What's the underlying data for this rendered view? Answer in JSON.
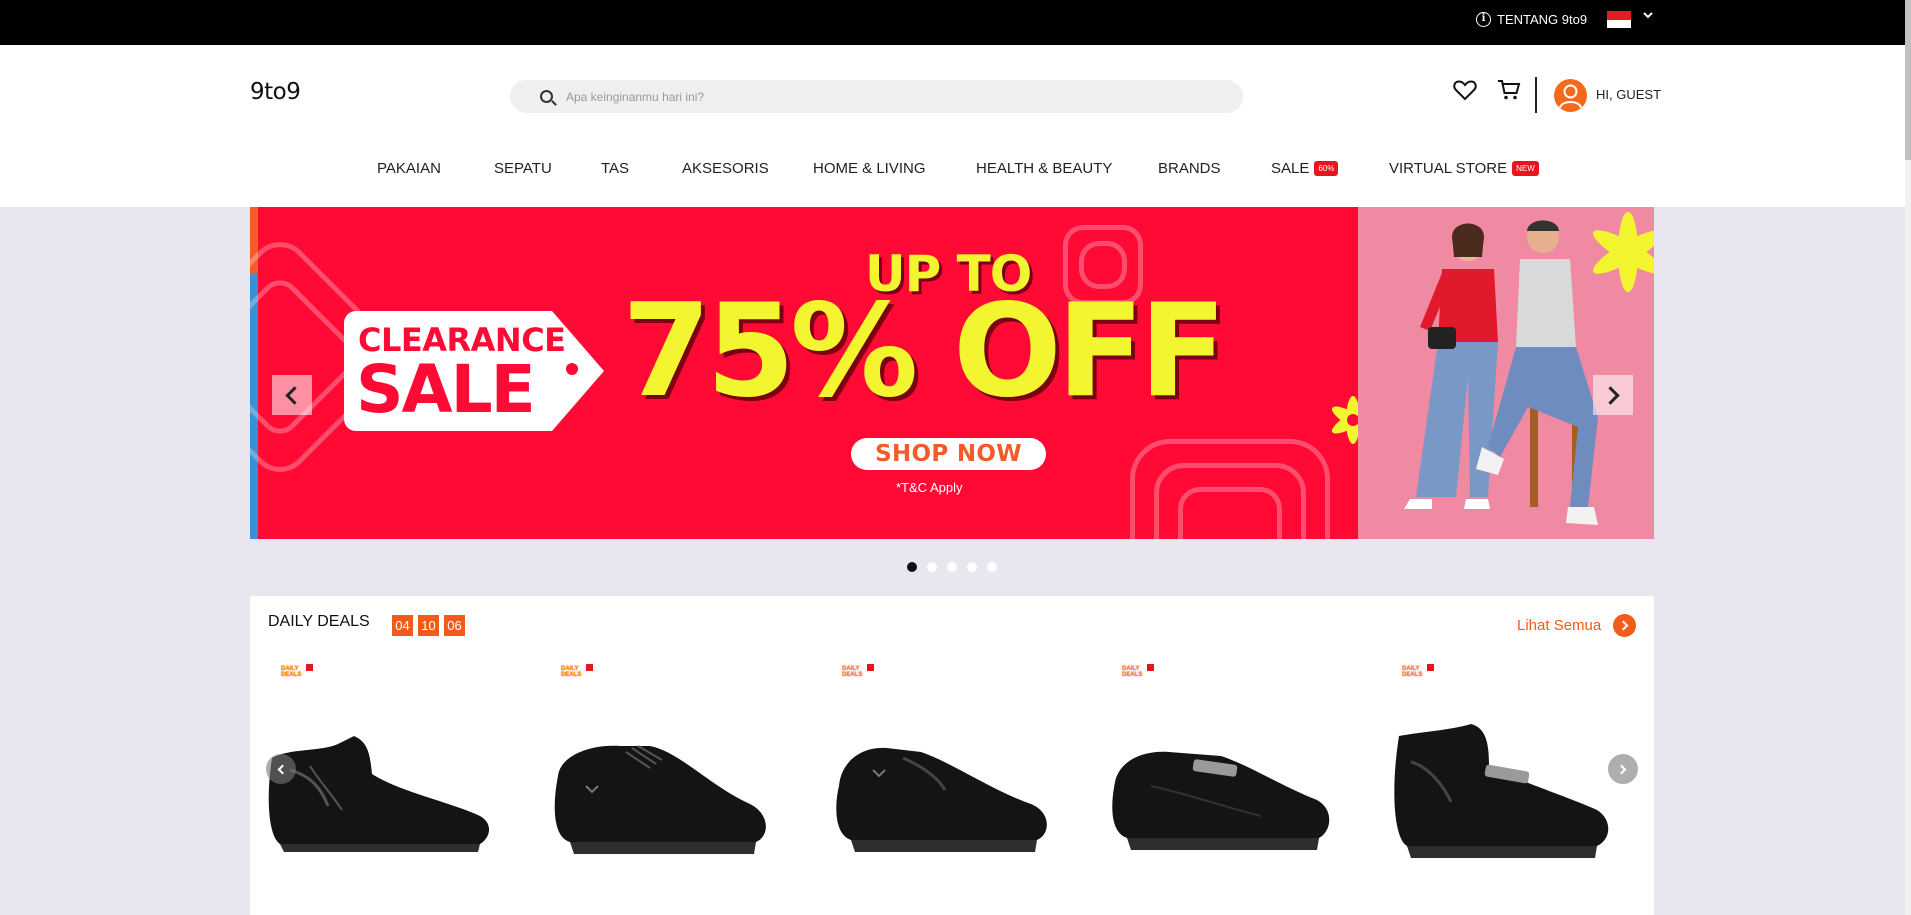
{
  "topbar": {
    "about_label": "TENTANG 9to9"
  },
  "header": {
    "logo": "9to9",
    "search_placeholder": "Apa keinginanmu hari ini?",
    "greeting": "HI, GUEST"
  },
  "nav": [
    {
      "label": "PAKAIAN"
    },
    {
      "label": "SEPATU"
    },
    {
      "label": "TAS"
    },
    {
      "label": "AKSESORIS"
    },
    {
      "label": "HOME & LIVING"
    },
    {
      "label": "HEALTH & BEAUTY"
    },
    {
      "label": "BRANDS"
    },
    {
      "label": "SALE",
      "badge": "60%"
    },
    {
      "label": "VIRTUAL STORE",
      "badge": "NEW"
    }
  ],
  "banner": {
    "tag_line1": "CLEARANCE",
    "tag_line2": "SALE",
    "up_to": "UP TO",
    "discount": "75% OFF",
    "cta": "SHOP NOW",
    "terms": "*T&C Apply",
    "slide_count": 5,
    "active_slide": 1
  },
  "deals": {
    "title": "DAILY DEALS",
    "timer": [
      "04",
      "10",
      "06"
    ],
    "see_all": "Lihat Semua",
    "badge_text": "DAILY DEALS",
    "products": [
      {
        "type": "ankle-boot"
      },
      {
        "type": "lace-up-derby"
      },
      {
        "type": "slip-on"
      },
      {
        "type": "loafer-buckle"
      },
      {
        "type": "boot-buckle"
      }
    ]
  },
  "colors": {
    "accent": "#f25b1a",
    "banner_red": "#ff0a35",
    "banner_yellow": "#f3f531",
    "badge_red": "#e8141e"
  }
}
